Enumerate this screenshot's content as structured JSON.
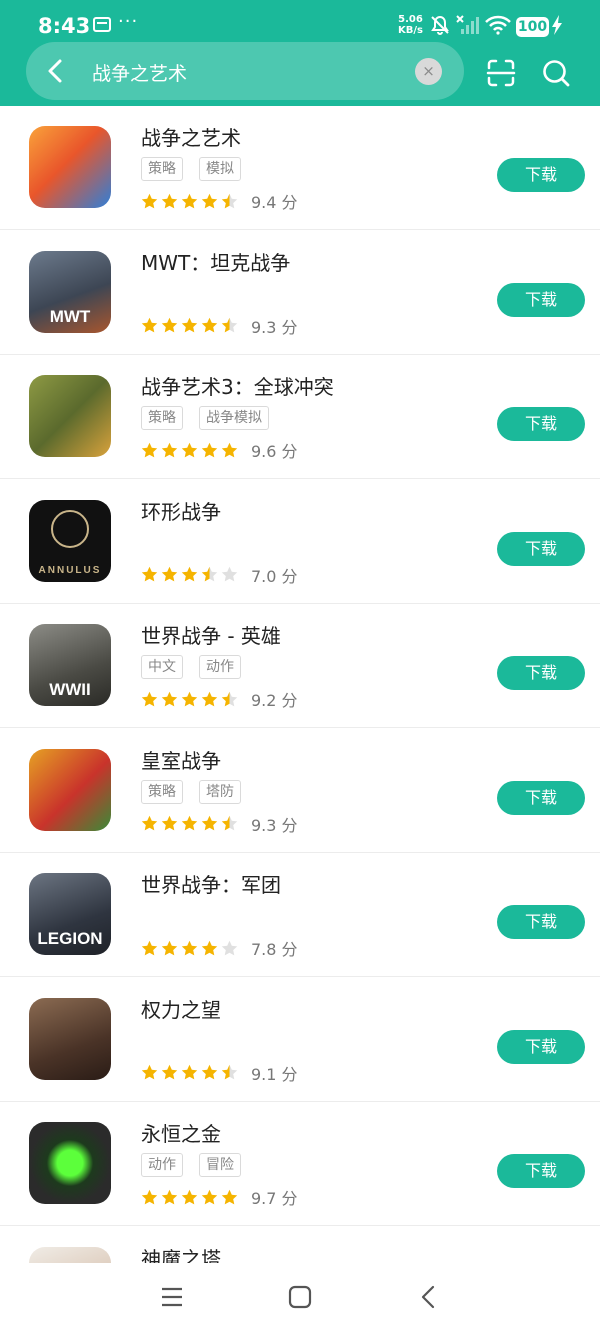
{
  "status_bar": {
    "time": "8:43",
    "net_speed_value": "5.06",
    "net_speed_unit": "KB/s",
    "battery": "100"
  },
  "search": {
    "query": "战争之艺术",
    "clear_symbol": "×"
  },
  "icons": {
    "back": "chevron-left-icon",
    "clear": "close-icon",
    "scan": "scan-icon",
    "search": "search-icon"
  },
  "colors": {
    "accent": "#1bb99a",
    "star": "#f5b400",
    "star_empty": "#e0e0e0"
  },
  "apps": [
    {
      "name": "战争之艺术",
      "tags": [
        "策略",
        "模拟"
      ],
      "rating": 4.5,
      "score": "9.4 分",
      "button": "下载"
    },
    {
      "name": "MWT：坦克战争",
      "tags": [],
      "rating": 4.5,
      "score": "9.3 分",
      "button": "下载"
    },
    {
      "name": "战争艺术3：全球冲突",
      "tags": [
        "策略",
        "战争模拟"
      ],
      "rating": 5,
      "score": "9.6 分",
      "button": "下载"
    },
    {
      "name": "环形战争",
      "tags": [],
      "rating": 3.5,
      "score": "7.0 分",
      "button": "下载"
    },
    {
      "name": "世界战争 - 英雄",
      "tags": [
        "中文",
        "动作"
      ],
      "rating": 4.5,
      "score": "9.2 分",
      "button": "下载"
    },
    {
      "name": "皇室战争",
      "tags": [
        "策略",
        "塔防"
      ],
      "rating": 4.5,
      "score": "9.3 分",
      "button": "下载"
    },
    {
      "name": "世界战争：军团",
      "tags": [],
      "rating": 4,
      "score": "7.8 分",
      "button": "下载"
    },
    {
      "name": "权力之望",
      "tags": [],
      "rating": 4.5,
      "score": "9.1 分",
      "button": "下载"
    },
    {
      "name": "永恒之金",
      "tags": [
        "动作",
        "冒险"
      ],
      "rating": 5,
      "score": "9.7 分",
      "button": "下载"
    },
    {
      "name": "神魔之塔",
      "tags": [],
      "rating": 0,
      "score": "",
      "button": ""
    }
  ],
  "app_icon_art": [
    {
      "label": "",
      "bg": "linear-gradient(135deg,#f9a23b,#e9562b 45%,#2f7fd8)"
    },
    {
      "label": "MWT",
      "bg": "linear-gradient(160deg,#6c7a8c,#3d4654 55%,#a8562e)"
    },
    {
      "label": "",
      "bg": "linear-gradient(135deg,#8e9a44,#5b6a2d 50%,#d9a23c)"
    },
    {
      "label": "ANNULUS",
      "bg": "#111111"
    },
    {
      "label": "WWII",
      "bg": "linear-gradient(160deg,#8c8c86,#4a4a44 60%,#2a2a26)"
    },
    {
      "label": "",
      "bg": "linear-gradient(135deg,#e6a124,#c9332b 55%,#3a8b38)"
    },
    {
      "label": "LEGION",
      "bg": "linear-gradient(160deg,#6c7582,#2f3540 60%,#1f2228)"
    },
    {
      "label": "",
      "bg": "linear-gradient(160deg,#8b6b52,#4a3327 60%,#2a1c16)"
    },
    {
      "label": "",
      "bg": "radial-gradient(circle,#5cff3b 0 22%,#1d3a1d 40%,#2b2b2b 70%)"
    },
    {
      "label": "",
      "bg": "linear-gradient(160deg,#f0ece6,#c9a88e)"
    }
  ],
  "nav": {
    "menu": "menu-icon",
    "home": "home-icon",
    "back": "back-icon"
  }
}
